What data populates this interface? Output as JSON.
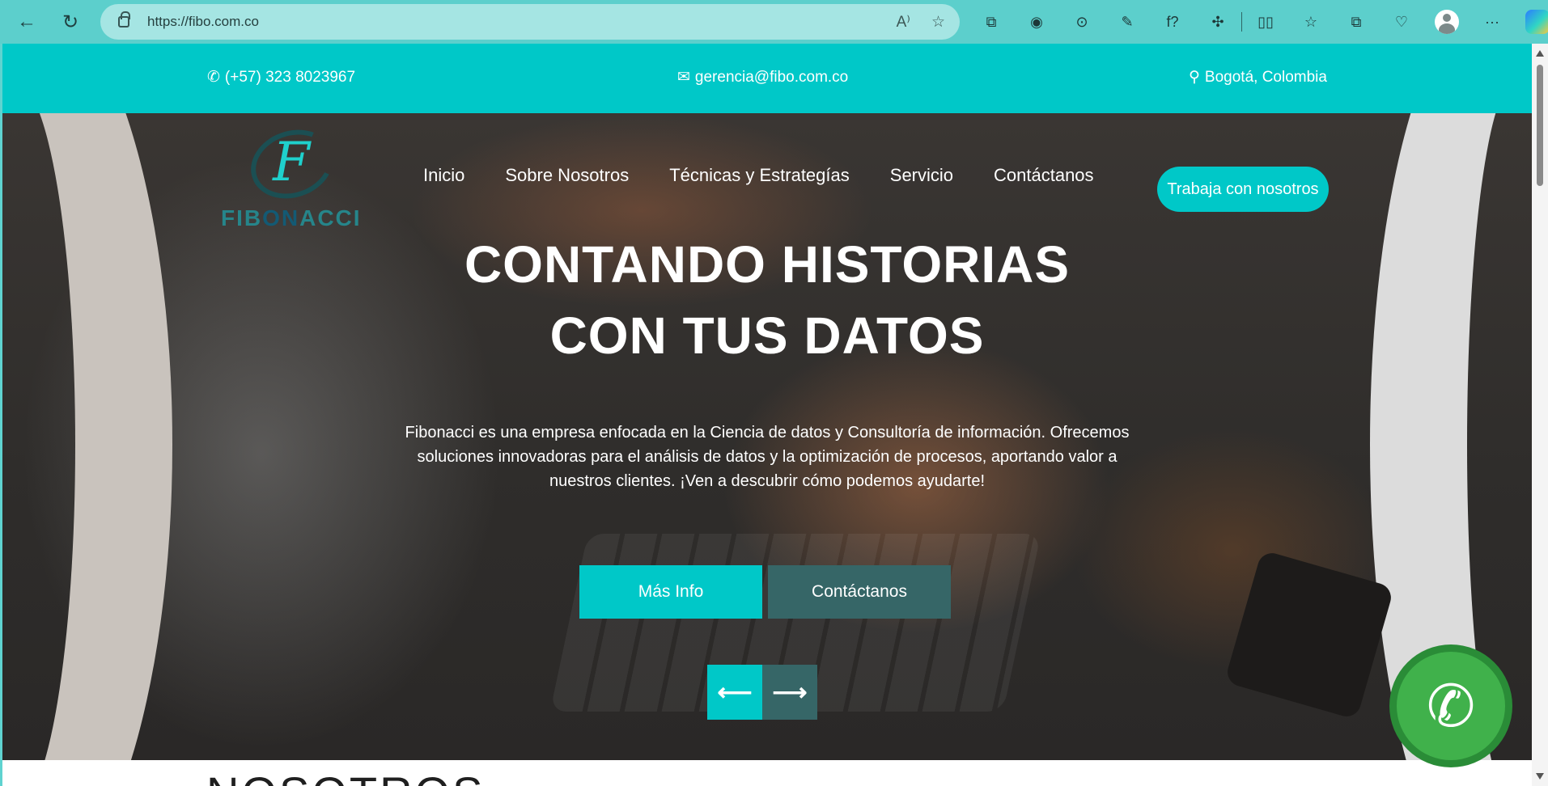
{
  "browser": {
    "url": "https://fibo.com.co",
    "nav": {
      "back_icon": "←",
      "reload_icon": "↻"
    },
    "address_icons": [
      {
        "name": "read-aloud-icon",
        "glyph": "A⁾"
      },
      {
        "name": "favorite-star-icon",
        "glyph": "☆"
      }
    ],
    "extensions": [
      {
        "name": "screenshot-extension-icon",
        "glyph": "⧉"
      },
      {
        "name": "camera-extension-icon",
        "glyph": "◉"
      },
      {
        "name": "record-extension-icon",
        "glyph": "⊙"
      },
      {
        "name": "eyedropper-icon",
        "glyph": "✎"
      },
      {
        "name": "formula-icon",
        "glyph": "f?"
      },
      {
        "name": "extensions-puzzle-icon",
        "glyph": "✣"
      },
      {
        "name": "split-screen-icon",
        "glyph": "▯▯"
      },
      {
        "name": "favorites-icon",
        "glyph": "☆"
      },
      {
        "name": "collections-icon",
        "glyph": "⧉"
      },
      {
        "name": "browser-essentials-icon",
        "glyph": "♡"
      }
    ],
    "more_icon": "···"
  },
  "topbar": {
    "phone": "(+57) 323 8023967",
    "email": "gerencia@fibo.com.co",
    "location": "Bogotá, Colombia",
    "phone_icon": "✆",
    "email_icon": "✉",
    "location_icon": "⚲"
  },
  "logo": {
    "mark": "F",
    "text_prefix": "FIB",
    "text_mid": "ON",
    "text_suffix": "ACCI"
  },
  "menu": {
    "items": [
      "Inicio",
      "Sobre Nosotros",
      "Técnicas y Estrategías",
      "Servicio",
      "Contáctanos"
    ],
    "cta": "Trabaja con nosotros"
  },
  "hero": {
    "headline_line1": "CONTANDO HISTORIAS",
    "headline_line2": "CON TUS DATOS",
    "description": "Fibonacci es una empresa enfocada en la Ciencia de datos y Consultoría de información. Ofrecemos soluciones innovadoras para el análisis de datos y la optimización de procesos, aportando valor a nuestros clientes. ¡Ven a descubrir cómo podemos ayudarte!",
    "btn_info": "Más Info",
    "btn_contact": "Contáctanos",
    "prev_icon": "⟵",
    "next_icon": "⟶"
  },
  "section": {
    "title": "NOSOTROS"
  },
  "whatsapp": {
    "icon": "✆"
  },
  "colors": {
    "accent": "#00c8c8",
    "secondary": "#366667",
    "whatsapp": "#40b14b"
  }
}
